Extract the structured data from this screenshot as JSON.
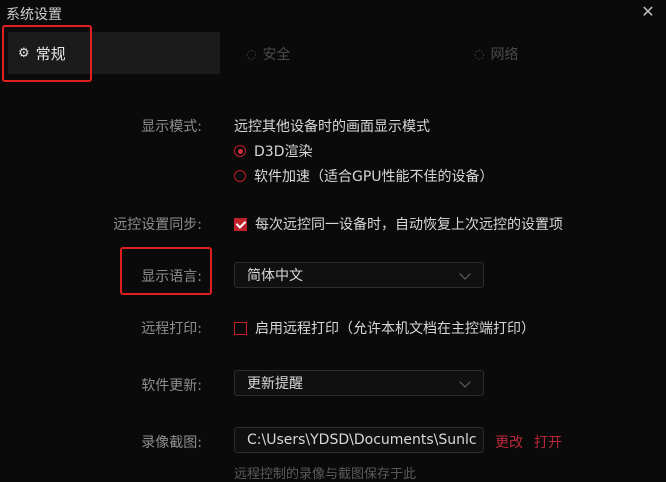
{
  "window": {
    "title": "系统设置",
    "close_icon": "close-icon"
  },
  "tabs": [
    {
      "label": "常规",
      "icon": "gear-icon",
      "active": true
    },
    {
      "label": "安全",
      "icon": "shield-icon",
      "active": false
    },
    {
      "label": "网络",
      "icon": "network-icon",
      "active": false
    }
  ],
  "display_mode": {
    "label": "显示模式:",
    "description": "远控其他设备时的画面显示模式",
    "options": [
      {
        "label": "D3D渲染",
        "selected": true
      },
      {
        "label": "软件加速（适合GPU性能不佳的设备）",
        "selected": false
      }
    ]
  },
  "sync": {
    "label": "远控设置同步:",
    "checkbox_label": "每次远控同一设备时，自动恢复上次远控的设置项",
    "checked": true
  },
  "language": {
    "label": "显示语言:",
    "value": "简体中文"
  },
  "remote_print": {
    "label": "远程打印:",
    "checkbox_label": "启用远程打印（允许本机文档在主控端打印）",
    "checked": false
  },
  "update": {
    "label": "软件更新:",
    "value": "更新提醒"
  },
  "recording": {
    "label": "录像截图:",
    "path": "C:\\Users\\YDSD\\Documents\\Sunlc",
    "change_label": "更改",
    "open_label": "打开",
    "hint": "远程控制的录像与截图保存于此"
  },
  "colors": {
    "accent": "#c0202a",
    "highlight_box": "#e02020",
    "background": "#0a0a0a"
  }
}
